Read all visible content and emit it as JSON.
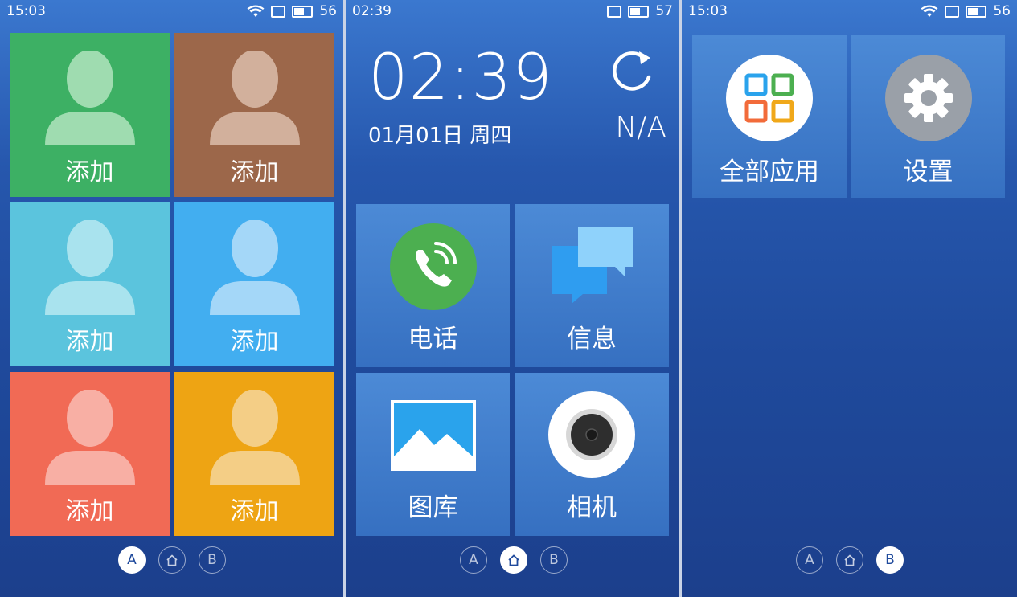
{
  "screens": {
    "contacts": {
      "status": {
        "time": "15:03",
        "battery": "56"
      },
      "tiles": [
        {
          "label": "添加",
          "bg": "#3db064",
          "sil": "#9fdcb0"
        },
        {
          "label": "添加",
          "bg": "#9c674a",
          "sil": "#d2b09c"
        },
        {
          "label": "添加",
          "bg": "#5bc4dd",
          "sil": "#a9e3ee"
        },
        {
          "label": "添加",
          "bg": "#42aef0",
          "sil": "#a4d7f8"
        },
        {
          "label": "添加",
          "bg": "#f16a55",
          "sil": "#f8afa4"
        },
        {
          "label": "添加",
          "bg": "#eea413",
          "sil": "#f4ce86"
        }
      ],
      "pager": {
        "left": "A",
        "right": "B",
        "active": "A"
      }
    },
    "home": {
      "status": {
        "time": "02:39",
        "battery": "57"
      },
      "clock": "02:39",
      "date": "01月01日 周四",
      "weather": "N/A",
      "apps": [
        {
          "label": "电话",
          "icon": "phone-icon"
        },
        {
          "label": "信息",
          "icon": "messages-icon"
        },
        {
          "label": "图库",
          "icon": "gallery-icon"
        },
        {
          "label": "相机",
          "icon": "camera-icon"
        }
      ],
      "pager": {
        "left": "A",
        "right": "B",
        "active": "home"
      }
    },
    "more": {
      "status": {
        "time": "15:03",
        "battery": "56"
      },
      "apps": [
        {
          "label": "全部应用",
          "icon": "all-apps-icon"
        },
        {
          "label": "设置",
          "icon": "settings-icon"
        }
      ],
      "pager": {
        "left": "A",
        "right": "B",
        "active": "B"
      }
    }
  },
  "colors": {
    "background_top": "#3b78cf",
    "background_bottom": "#1c3f8c",
    "phone_green": "#4caf50",
    "message_blue": "#2f9df0"
  }
}
